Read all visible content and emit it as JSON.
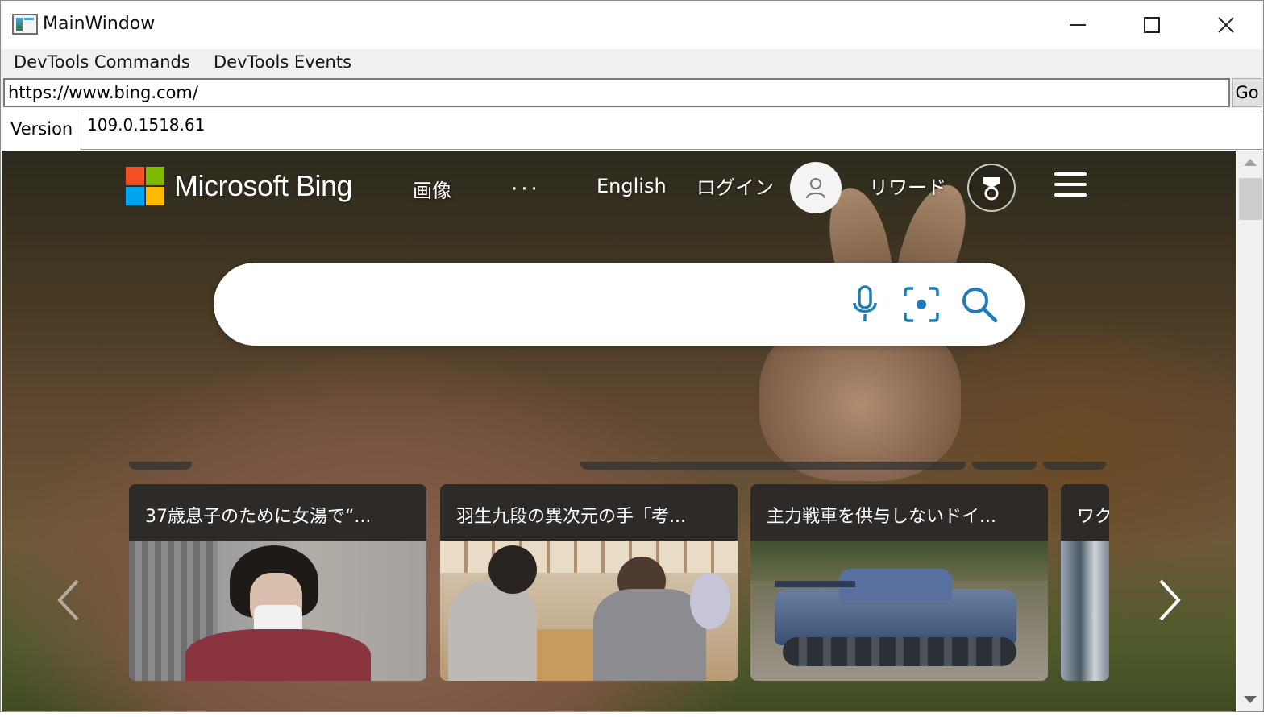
{
  "window": {
    "title": "MainWindow",
    "controls": {
      "minimize": "minimize",
      "maximize": "maximize",
      "close": "✕"
    }
  },
  "menu": {
    "items": [
      "DevTools Commands",
      "DevTools Events"
    ]
  },
  "address": {
    "url": "https://www.bing.com/",
    "go_label": "Go"
  },
  "version": {
    "label": "Version",
    "value": "109.0.1518.61"
  },
  "bing": {
    "brand": "Microsoft Bing",
    "nav": {
      "images": "画像",
      "more": "···",
      "language": "English",
      "login": "ログイン",
      "rewards": "リワード"
    },
    "icons": {
      "mic": "microphone-icon",
      "visual": "visual-search-icon",
      "search": "search-icon",
      "menu": "hamburger-menu-icon",
      "user": "user-icon",
      "rewards": "rewards-medal-icon"
    },
    "colors": {
      "ms_red": "#f25022",
      "ms_green": "#7fba00",
      "ms_blue": "#00a4ef",
      "ms_yellow": "#ffb900",
      "search_icon": "#1f7eb8"
    },
    "carousel": {
      "cards": [
        {
          "title": "37歳息子のために女湯で“..."
        },
        {
          "title": "羽生九段の異次元の手「考..."
        },
        {
          "title": "主力戦車を供与しないドイ..."
        },
        {
          "title": "ワク"
        }
      ]
    }
  }
}
